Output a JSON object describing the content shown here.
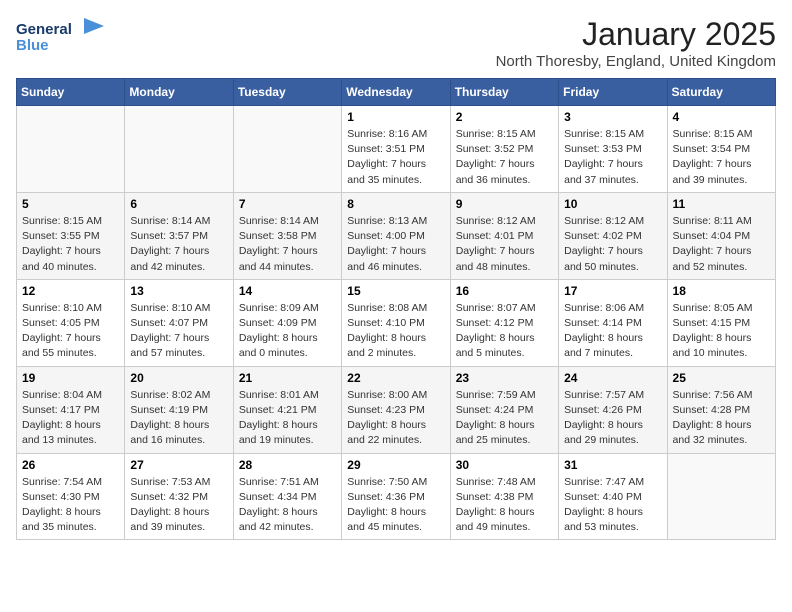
{
  "header": {
    "logo_line1": "General",
    "logo_line2": "Blue",
    "title": "January 2025",
    "subtitle": "North Thoresby, England, United Kingdom"
  },
  "weekdays": [
    "Sunday",
    "Monday",
    "Tuesday",
    "Wednesday",
    "Thursday",
    "Friday",
    "Saturday"
  ],
  "weeks": [
    [
      {
        "day": "",
        "info": ""
      },
      {
        "day": "",
        "info": ""
      },
      {
        "day": "",
        "info": ""
      },
      {
        "day": "1",
        "info": "Sunrise: 8:16 AM\nSunset: 3:51 PM\nDaylight: 7 hours and 35 minutes."
      },
      {
        "day": "2",
        "info": "Sunrise: 8:15 AM\nSunset: 3:52 PM\nDaylight: 7 hours and 36 minutes."
      },
      {
        "day": "3",
        "info": "Sunrise: 8:15 AM\nSunset: 3:53 PM\nDaylight: 7 hours and 37 minutes."
      },
      {
        "day": "4",
        "info": "Sunrise: 8:15 AM\nSunset: 3:54 PM\nDaylight: 7 hours and 39 minutes."
      }
    ],
    [
      {
        "day": "5",
        "info": "Sunrise: 8:15 AM\nSunset: 3:55 PM\nDaylight: 7 hours and 40 minutes."
      },
      {
        "day": "6",
        "info": "Sunrise: 8:14 AM\nSunset: 3:57 PM\nDaylight: 7 hours and 42 minutes."
      },
      {
        "day": "7",
        "info": "Sunrise: 8:14 AM\nSunset: 3:58 PM\nDaylight: 7 hours and 44 minutes."
      },
      {
        "day": "8",
        "info": "Sunrise: 8:13 AM\nSunset: 4:00 PM\nDaylight: 7 hours and 46 minutes."
      },
      {
        "day": "9",
        "info": "Sunrise: 8:12 AM\nSunset: 4:01 PM\nDaylight: 7 hours and 48 minutes."
      },
      {
        "day": "10",
        "info": "Sunrise: 8:12 AM\nSunset: 4:02 PM\nDaylight: 7 hours and 50 minutes."
      },
      {
        "day": "11",
        "info": "Sunrise: 8:11 AM\nSunset: 4:04 PM\nDaylight: 7 hours and 52 minutes."
      }
    ],
    [
      {
        "day": "12",
        "info": "Sunrise: 8:10 AM\nSunset: 4:05 PM\nDaylight: 7 hours and 55 minutes."
      },
      {
        "day": "13",
        "info": "Sunrise: 8:10 AM\nSunset: 4:07 PM\nDaylight: 7 hours and 57 minutes."
      },
      {
        "day": "14",
        "info": "Sunrise: 8:09 AM\nSunset: 4:09 PM\nDaylight: 8 hours and 0 minutes."
      },
      {
        "day": "15",
        "info": "Sunrise: 8:08 AM\nSunset: 4:10 PM\nDaylight: 8 hours and 2 minutes."
      },
      {
        "day": "16",
        "info": "Sunrise: 8:07 AM\nSunset: 4:12 PM\nDaylight: 8 hours and 5 minutes."
      },
      {
        "day": "17",
        "info": "Sunrise: 8:06 AM\nSunset: 4:14 PM\nDaylight: 8 hours and 7 minutes."
      },
      {
        "day": "18",
        "info": "Sunrise: 8:05 AM\nSunset: 4:15 PM\nDaylight: 8 hours and 10 minutes."
      }
    ],
    [
      {
        "day": "19",
        "info": "Sunrise: 8:04 AM\nSunset: 4:17 PM\nDaylight: 8 hours and 13 minutes."
      },
      {
        "day": "20",
        "info": "Sunrise: 8:02 AM\nSunset: 4:19 PM\nDaylight: 8 hours and 16 minutes."
      },
      {
        "day": "21",
        "info": "Sunrise: 8:01 AM\nSunset: 4:21 PM\nDaylight: 8 hours and 19 minutes."
      },
      {
        "day": "22",
        "info": "Sunrise: 8:00 AM\nSunset: 4:23 PM\nDaylight: 8 hours and 22 minutes."
      },
      {
        "day": "23",
        "info": "Sunrise: 7:59 AM\nSunset: 4:24 PM\nDaylight: 8 hours and 25 minutes."
      },
      {
        "day": "24",
        "info": "Sunrise: 7:57 AM\nSunset: 4:26 PM\nDaylight: 8 hours and 29 minutes."
      },
      {
        "day": "25",
        "info": "Sunrise: 7:56 AM\nSunset: 4:28 PM\nDaylight: 8 hours and 32 minutes."
      }
    ],
    [
      {
        "day": "26",
        "info": "Sunrise: 7:54 AM\nSunset: 4:30 PM\nDaylight: 8 hours and 35 minutes."
      },
      {
        "day": "27",
        "info": "Sunrise: 7:53 AM\nSunset: 4:32 PM\nDaylight: 8 hours and 39 minutes."
      },
      {
        "day": "28",
        "info": "Sunrise: 7:51 AM\nSunset: 4:34 PM\nDaylight: 8 hours and 42 minutes."
      },
      {
        "day": "29",
        "info": "Sunrise: 7:50 AM\nSunset: 4:36 PM\nDaylight: 8 hours and 45 minutes."
      },
      {
        "day": "30",
        "info": "Sunrise: 7:48 AM\nSunset: 4:38 PM\nDaylight: 8 hours and 49 minutes."
      },
      {
        "day": "31",
        "info": "Sunrise: 7:47 AM\nSunset: 4:40 PM\nDaylight: 8 hours and 53 minutes."
      },
      {
        "day": "",
        "info": ""
      }
    ]
  ]
}
